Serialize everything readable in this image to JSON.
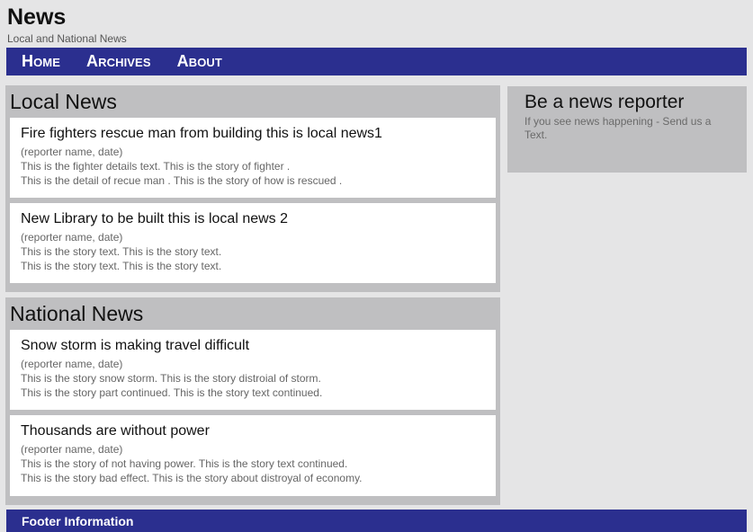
{
  "header": {
    "title": "News",
    "tagline": "Local and National News"
  },
  "nav": {
    "items": [
      {
        "label": "Home"
      },
      {
        "label": "Archives"
      },
      {
        "label": "About"
      }
    ]
  },
  "local_news": {
    "title": "Local News",
    "stories": [
      {
        "headline": "Fire fighters rescue man from building this is local news1",
        "meta": "(reporter name, date)",
        "line1": "This is the fighter details text. This is the story of fighter .",
        "line2": "This is the detail of recue man . This is the story of how is rescued ."
      },
      {
        "headline": "New Library to be built this is local news 2",
        "meta": "(reporter name, date)",
        "line1": "This is the story text. This is the story text.",
        "line2": "This is the story text. This is the story text."
      }
    ]
  },
  "national_news": {
    "title": "National News",
    "stories": [
      {
        "headline": "Snow storm is making travel difficult",
        "meta": "(reporter name, date)",
        "line1": "This is the story snow storm. This is the story distroial of storm.",
        "line2": "This is the story part continued. This is the story text continued."
      },
      {
        "headline": "Thousands are without power",
        "meta": "(reporter name, date)",
        "line1": "This is the story of not having power. This is the story text continued.",
        "line2": "This is the story bad effect. This is the story about distroyal of economy."
      }
    ]
  },
  "sidebar": {
    "title": "Be a news reporter",
    "text": "If you see news happening - Send us a Text."
  },
  "footer": {
    "text": "Footer Information"
  },
  "colors": {
    "nav_bg": "#2b2f8f",
    "section_bg": "#bfbfc1",
    "page_bg": "#e5e5e6"
  }
}
